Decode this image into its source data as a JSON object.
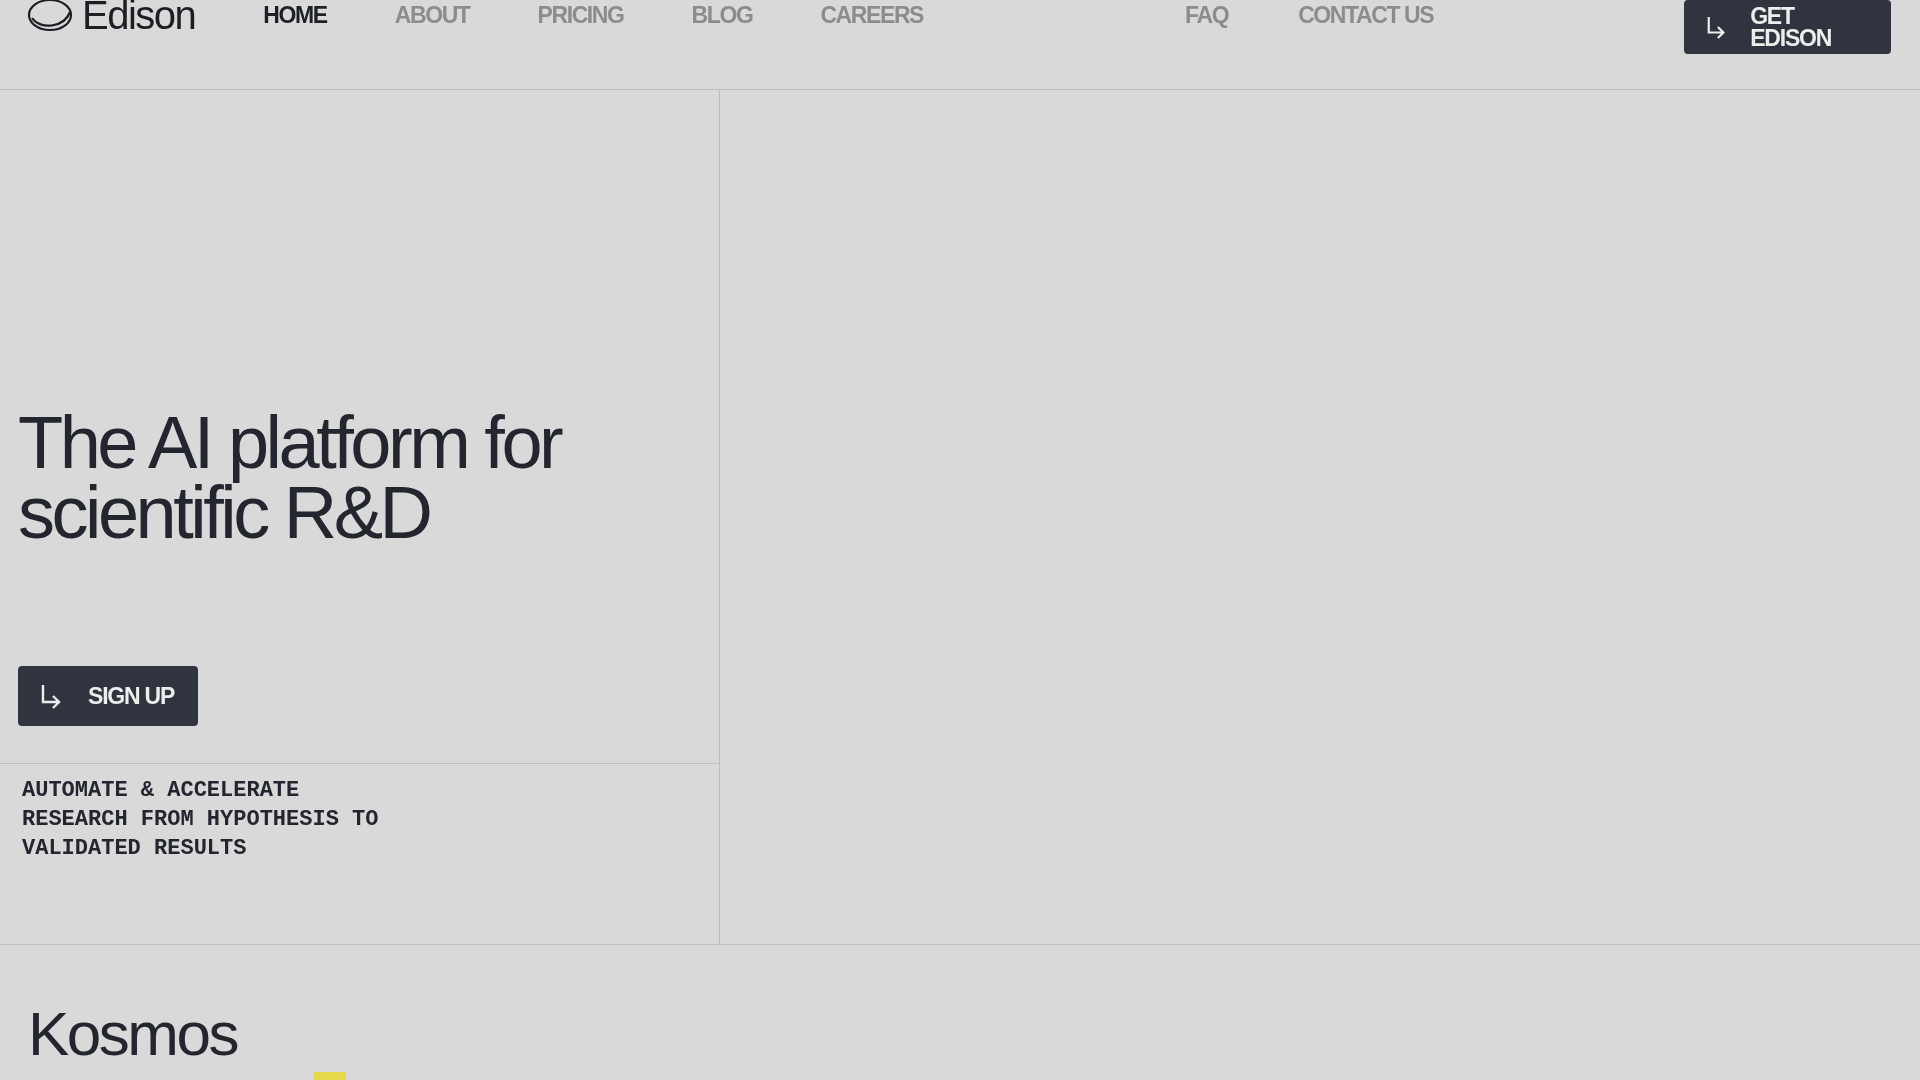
{
  "header": {
    "logo": "Edison",
    "nav": [
      {
        "label": "HOME",
        "selected": true
      },
      {
        "label": "ABOUT",
        "selected": false
      },
      {
        "label": "PRICING",
        "selected": false
      },
      {
        "label": "BLOG",
        "selected": false
      },
      {
        "label": "CAREERS",
        "selected": false
      }
    ],
    "nav_right": [
      {
        "label": "FAQ",
        "selected": false
      },
      {
        "label": "CONTACT US",
        "selected": false
      }
    ],
    "cta": "GET EDISON"
  },
  "hero": {
    "heading": "The AI platform for scientific R&D",
    "button": "SIGN UP",
    "tagline": "AUTOMATE & ACCELERATE RESEARCH FROM HYPOTHESIS TO VALIDATED RESULTS"
  },
  "section": {
    "title": "Kosmos"
  }
}
